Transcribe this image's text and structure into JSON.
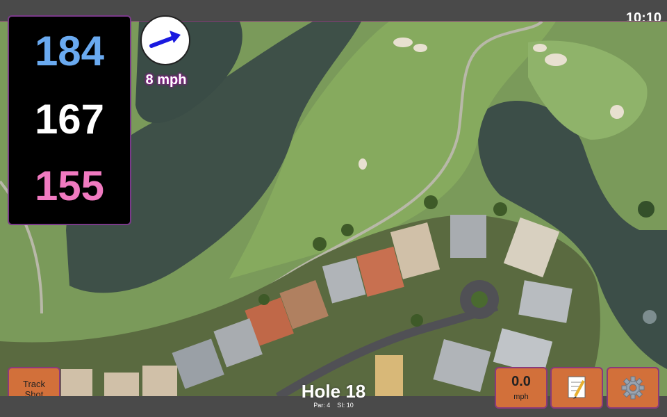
{
  "status": {
    "clock": "10:10"
  },
  "distances": {
    "back": "184",
    "middle": "167",
    "front": "155"
  },
  "wind": {
    "speed": "8 mph",
    "icon": "wind-arrow-icon",
    "arrow_color": "#1a1ae0"
  },
  "track_shot": {
    "label_line1": "Track",
    "label_line2": "Shot"
  },
  "hole": {
    "title": "Hole 18",
    "par_label": "Par: 4",
    "si_label": "SI: 10"
  },
  "shot_speed": {
    "value": "0.0",
    "unit": "mph"
  },
  "notes_button": {
    "icon": "notepad-icon"
  },
  "settings_button": {
    "icon": "gear-icon"
  },
  "colors": {
    "back": "#6aaaf0",
    "middle": "#ffffff",
    "front": "#f07ac0",
    "button": "#d2703a",
    "border": "#7a3a8a"
  }
}
